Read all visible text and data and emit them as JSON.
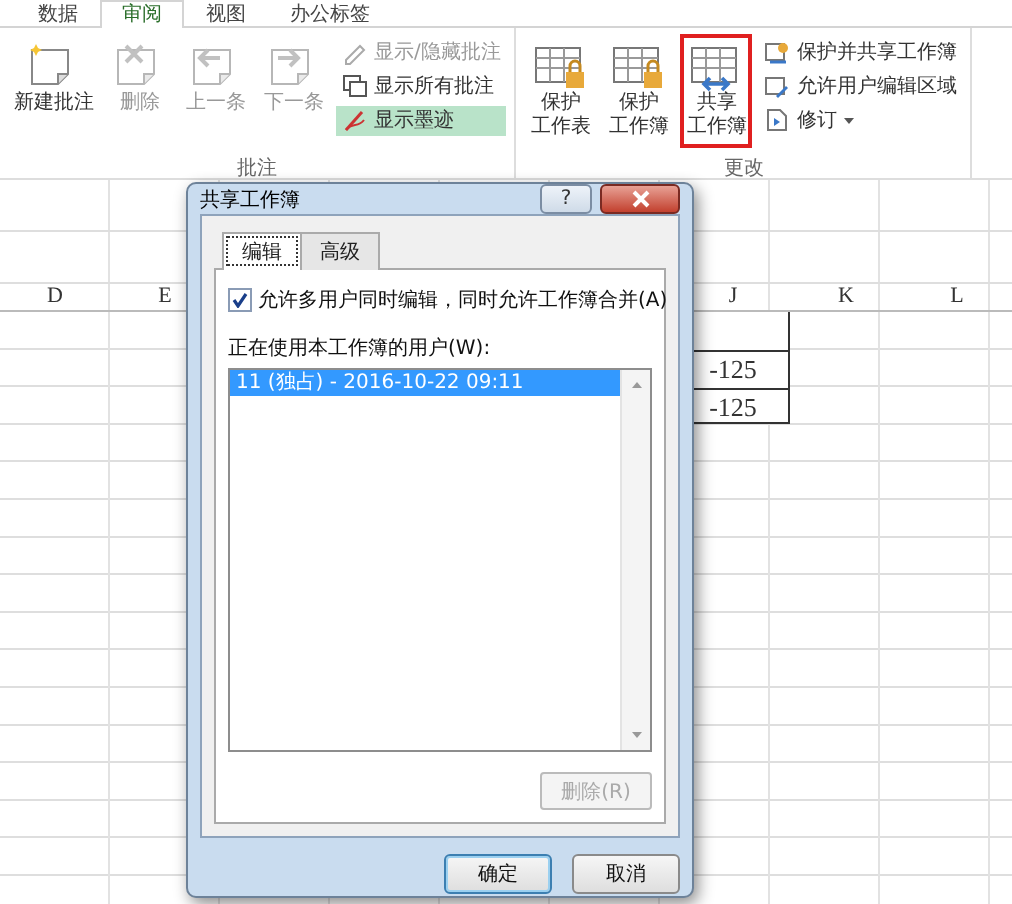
{
  "ribbon_tabs": [
    {
      "label": "数据",
      "selected": false
    },
    {
      "label": "审阅",
      "selected": true
    },
    {
      "label": "视图",
      "selected": false
    },
    {
      "label": "办公标签",
      "selected": false
    }
  ],
  "ribbon_groups": [
    {
      "label": "批注",
      "large_buttons": [
        {
          "kind": "newcomment",
          "lines": [
            "新建批注"
          ],
          "disabled": false,
          "highlighted": false
        },
        {
          "kind": "deletecomment",
          "lines": [
            "删除"
          ],
          "disabled": true,
          "highlighted": false
        },
        {
          "kind": "previous",
          "lines": [
            "上一条"
          ],
          "disabled": true,
          "highlighted": false
        },
        {
          "kind": "next",
          "lines": [
            "下一条"
          ],
          "disabled": true,
          "highlighted": false
        }
      ],
      "small_buttons": [
        {
          "kind": "togglecomment",
          "label": "显示/隐藏批注",
          "disabled": true,
          "active": false,
          "menu": false
        },
        {
          "kind": "allcomments",
          "label": "显示所有批注",
          "disabled": false,
          "active": false,
          "menu": false
        },
        {
          "kind": "ink",
          "label": "显示墨迹",
          "disabled": false,
          "active": true,
          "menu": false
        }
      ]
    },
    {
      "label": "更改",
      "large_buttons": [
        {
          "kind": "protectsheet",
          "lines": [
            "保护",
            "工作表"
          ],
          "disabled": false,
          "highlighted": false
        },
        {
          "kind": "protectbook",
          "lines": [
            "保护",
            "工作簿"
          ],
          "disabled": false,
          "highlighted": false
        },
        {
          "kind": "sharebook",
          "lines": [
            "共享",
            "工作簿"
          ],
          "disabled": false,
          "highlighted": true
        }
      ],
      "small_buttons": [
        {
          "kind": "protectshare",
          "label": "保护并共享工作簿",
          "disabled": false,
          "active": false,
          "menu": false
        },
        {
          "kind": "allowedit",
          "label": "允许用户编辑区域",
          "disabled": false,
          "active": false,
          "menu": false
        },
        {
          "kind": "track",
          "label": "修订",
          "disabled": false,
          "active": false,
          "menu": true
        }
      ]
    }
  ],
  "sheet": {
    "columns_left": [
      "D",
      "E"
    ],
    "columns_right": [
      "J",
      "K",
      "L"
    ],
    "j_values": [
      "-125",
      "-125"
    ]
  },
  "dialog": {
    "title": "共享工作簿",
    "help_label": "?",
    "tabs": [
      {
        "label": "编辑",
        "selected": true
      },
      {
        "label": "高级",
        "selected": false
      }
    ],
    "allow_multi_user": {
      "label": "允许多用户同时编辑，同时允许工作簿合并(A)",
      "checked": true
    },
    "users_label": "正在使用本工作簿的用户(W):",
    "users": [
      {
        "text": "11 (独占) - 2016-10-22 09:11",
        "selected": true
      }
    ],
    "remove_button": {
      "label": "删除(R)",
      "disabled": true
    },
    "buttons": [
      {
        "label": "确定",
        "default": true
      },
      {
        "label": "取消",
        "default": false
      }
    ]
  }
}
